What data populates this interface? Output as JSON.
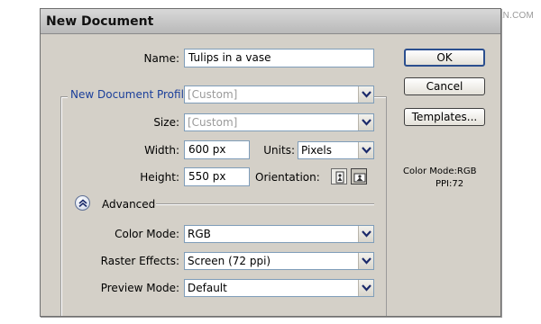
{
  "watermark": "思缘设计论坛 WWW.MISSYUAN.COM",
  "dialog": {
    "title": "New Document"
  },
  "name_field": {
    "label": "Name:",
    "value": "Tulips in a vase"
  },
  "profile": {
    "legend": "New Document Profile:",
    "value": "[Custom]"
  },
  "size": {
    "label": "Size:",
    "value": "[Custom]"
  },
  "width": {
    "label": "Width:",
    "value": "600 px"
  },
  "units": {
    "label": "Units:",
    "value": "Pixels"
  },
  "height": {
    "label": "Height:",
    "value": "550 px"
  },
  "orientation": {
    "label": "Orientation:",
    "selected": "landscape"
  },
  "advanced": {
    "label": "Advanced",
    "expanded": true
  },
  "color_mode": {
    "label": "Color Mode:",
    "value": "RGB"
  },
  "raster_effects": {
    "label": "Raster Effects:",
    "value": "Screen (72 ppi)"
  },
  "preview_mode": {
    "label": "Preview Mode:",
    "value": "Default"
  },
  "buttons": {
    "ok": "OK",
    "cancel": "Cancel",
    "templates": "Templates..."
  },
  "info": {
    "color_mode": "Color Mode:RGB",
    "ppi": "PPI:72"
  },
  "icons": {
    "dropdown": "chevron-down-icon",
    "portrait": "portrait-orientation-icon",
    "landscape": "landscape-orientation-icon",
    "advanced_toggle": "double-chevron-up-icon"
  },
  "colors": {
    "legend_text": "#1a3e9a",
    "dialog_bg": "#d4d0c8",
    "field_border": "#7f9db9"
  }
}
